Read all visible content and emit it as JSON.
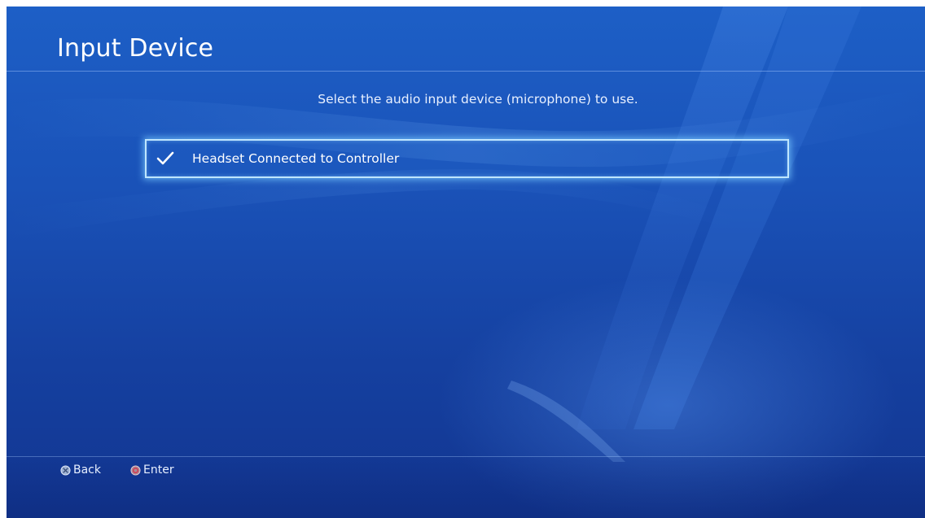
{
  "screen": {
    "title": "Input Device",
    "instruction": "Select the audio input device (microphone) to use."
  },
  "options": [
    {
      "label": "Headset Connected to Controller",
      "selected": true,
      "icon": "checkmark-icon"
    }
  ],
  "footer": {
    "back": {
      "icon": "cross-button-icon",
      "label": "Back"
    },
    "enter": {
      "icon": "circle-button-icon",
      "label": "Enter"
    }
  },
  "colors": {
    "background": "#1a52b8",
    "focus_border": "#bfe6ff",
    "text": "#ffffff"
  }
}
